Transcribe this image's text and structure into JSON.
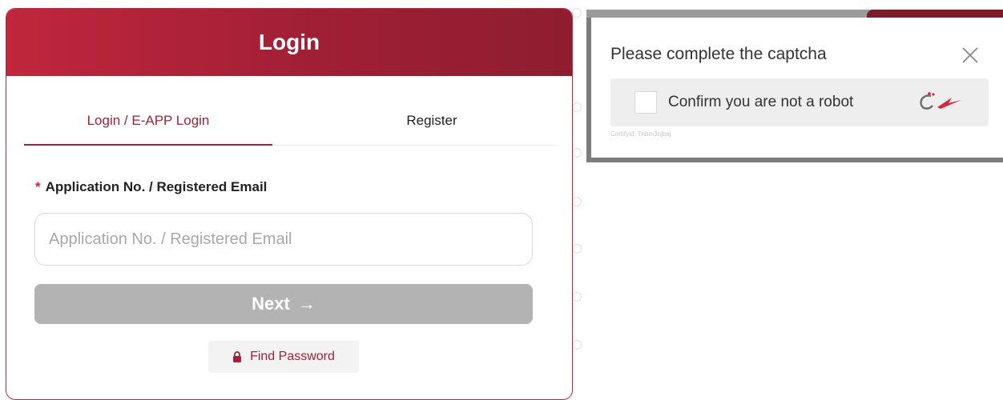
{
  "login_card": {
    "title": "Login",
    "tabs": [
      {
        "label": "Login / E-APP Login",
        "active": true
      },
      {
        "label": "Register",
        "active": false
      }
    ],
    "field": {
      "required_mark": "*",
      "label": "Application No. / Registered Email",
      "value": "",
      "placeholder": "Application No. / Registered Email"
    },
    "next_button": {
      "label": "Next",
      "icon": "arrow-right-icon"
    },
    "find_password": {
      "label": "Find Password",
      "icon": "lock-icon"
    }
  },
  "captcha": {
    "title": "Please complete the captcha",
    "checkbox_label": "Confirm you are not a robot",
    "footer": "Certifyid: Tnbm3njbaj",
    "close_icon": "close-icon"
  },
  "colors": {
    "brand": "#a3213a",
    "header_gradient_start": "#c0263d",
    "header_gradient_end": "#8e1d30",
    "disabled_button": "#b3b3b3"
  }
}
